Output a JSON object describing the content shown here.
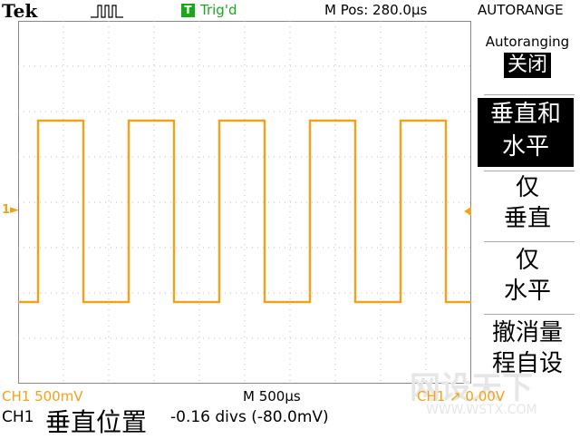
{
  "header": {
    "brand": "Tek",
    "pulse_icon": "single-pulse-icon",
    "trigger_badge": "T",
    "trigger_status": "Trig'd",
    "m_pos": "M Pos: 280.0µs",
    "autorange": "AUTORANGE"
  },
  "waveform": {
    "channel_marker": "1",
    "color": "#f2a11a",
    "type": "square",
    "cycles": 5
  },
  "menu": {
    "title": "Autoranging",
    "off_label": "关闭",
    "items": [
      {
        "line1": "垂直和",
        "line2": "水平",
        "selected": true
      },
      {
        "line1": "仅",
        "line2": "垂直",
        "selected": false
      },
      {
        "line1": "仅",
        "line2": "水平",
        "selected": false
      },
      {
        "line1": "撤消量",
        "line2": "程自设",
        "selected": false
      }
    ]
  },
  "status": {
    "ch1_scale": "CH1  500mV",
    "timebase": "M 500µs",
    "trigger": "CH1 ↗ 0.00V"
  },
  "message": {
    "channel": "CH1",
    "label": "垂直位置",
    "value": "-0.16 divs (-80.0mV)"
  }
}
